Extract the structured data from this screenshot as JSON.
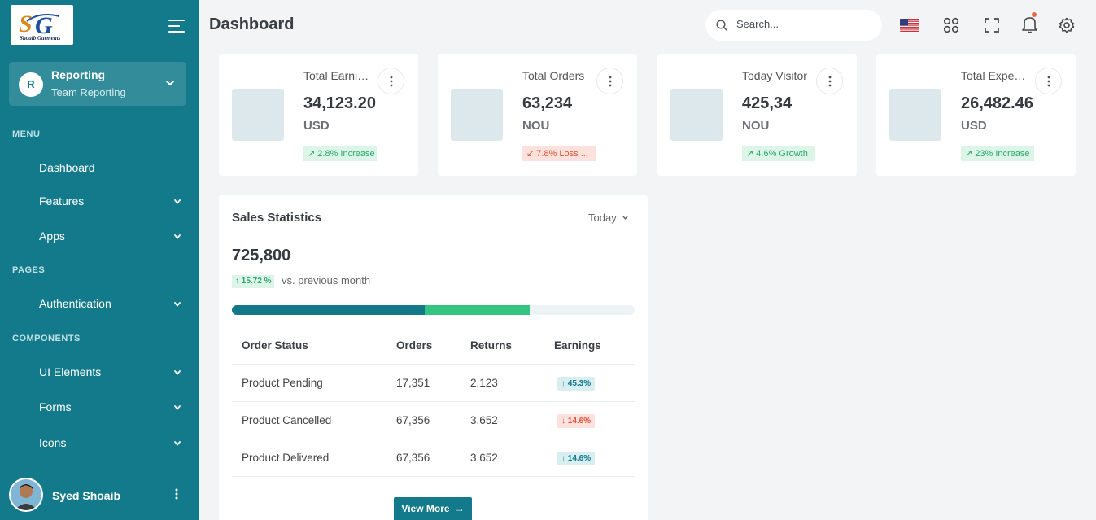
{
  "colors": {
    "sidebar": "#127a8a",
    "accent": "#127a8a",
    "success": "#2aa86a",
    "danger": "#e0533b",
    "bar_primary": "#12788a",
    "bar_secondary": "#35c482"
  },
  "sidebar": {
    "logo_text": "Shoaib Garments",
    "team": {
      "initial": "R",
      "title": "Reporting",
      "subtitle": "Team Reporting"
    },
    "sections": {
      "menu": "MENU",
      "pages": "PAGES",
      "components": "COMPONENTS"
    },
    "items": [
      {
        "label": "Dashboard",
        "has_children": false
      },
      {
        "label": "Features",
        "has_children": true
      },
      {
        "label": "Apps",
        "has_children": true
      },
      {
        "label": "Authentication",
        "has_children": true
      },
      {
        "label": "UI Elements",
        "has_children": true
      },
      {
        "label": "Forms",
        "has_children": true
      },
      {
        "label": "Icons",
        "has_children": true
      }
    ],
    "user": {
      "name": "Syed Shoaib"
    }
  },
  "header": {
    "title": "Dashboard",
    "search_placeholder": "Search...",
    "icons": [
      "us-flag-icon",
      "apps-grid-icon",
      "fullscreen-icon",
      "bell-icon",
      "gear-icon"
    ]
  },
  "stats": [
    {
      "title": "Total Earnings",
      "value": "34,123.20",
      "unit": "USD",
      "change": "↗ 2.8% Increase",
      "trend": "up"
    },
    {
      "title": "Total Orders",
      "value": "63,234",
      "unit": "NOU",
      "change": "↙ 7.8% Loss ...",
      "trend": "down"
    },
    {
      "title": "Today Visitor",
      "value": "425,34",
      "unit": "NOU",
      "change": "↗ 4.6% Growth",
      "trend": "up"
    },
    {
      "title": "Total Expenses",
      "value": "26,482.46",
      "unit": "USD",
      "change": "↗ 23% Increase",
      "trend": "up"
    }
  ],
  "sales": {
    "title": "Sales Statistics",
    "period": "Today",
    "total": "725,800",
    "change": "↑ 15.72 %",
    "comparison": "vs. previous month",
    "progress": [
      {
        "fraction": 0.478,
        "color": "#12788a"
      },
      {
        "fraction": 0.262,
        "color": "#35c482"
      }
    ],
    "table": {
      "headers": [
        "Order Status",
        "Orders",
        "Returns",
        "Earnings"
      ],
      "rows": [
        {
          "status": "Product Pending",
          "orders": "17,351",
          "returns": "2,123",
          "earnings": "↑ 45.3%",
          "trend": "up"
        },
        {
          "status": "Product Cancelled",
          "orders": "67,356",
          "returns": "3,652",
          "earnings": "↓ 14.6%",
          "trend": "down"
        },
        {
          "status": "Product Delivered",
          "orders": "67,356",
          "returns": "3,652",
          "earnings": "↑ 14.6%",
          "trend": "up"
        }
      ]
    },
    "view_more": "View More"
  }
}
